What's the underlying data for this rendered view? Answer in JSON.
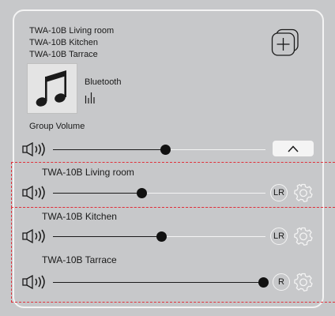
{
  "group": {
    "members": [
      "TWA-10B Living room",
      "TWA-10B Kitchen",
      "TWA-10B Tarrace"
    ],
    "source_label": "Bluetooth",
    "group_volume_label": "Group Volume",
    "group_volume_value": 0.53
  },
  "zones": [
    {
      "name": "TWA-10B Living room",
      "volume": 0.42,
      "channel": "LR"
    },
    {
      "name": "TWA-10B Kitchen",
      "volume": 0.51,
      "channel": "LR"
    },
    {
      "name": "TWA-10B Tarrace",
      "volume": 0.99,
      "channel": "R"
    }
  ],
  "colors": {
    "background": "#c7c8ca",
    "outline": "#f4f4f4",
    "selection_dash": "#e0303a",
    "knob": "#111111"
  },
  "icons": {
    "add": "add-copy-icon",
    "album": "music-note-icon",
    "equalizer": "equalizer-icon",
    "speaker": "speaker-icon",
    "collapse": "chevron-up-icon",
    "settings": "gear-icon"
  }
}
